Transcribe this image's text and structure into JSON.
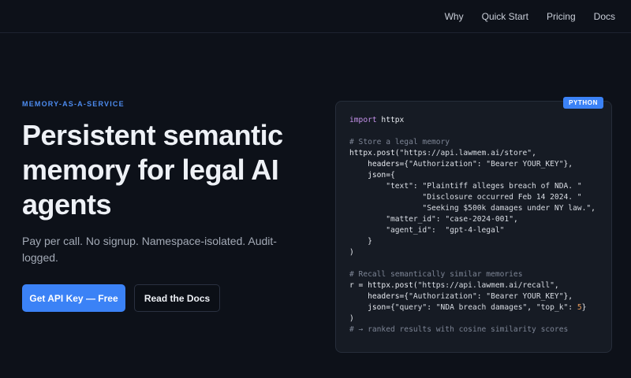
{
  "nav": {
    "links": [
      "Why",
      "Quick Start",
      "Pricing",
      "Docs"
    ]
  },
  "hero": {
    "eyebrow": "MEMORY-AS-A-SERVICE",
    "headline": "Persistent semantic memory for legal AI agents",
    "subtitle": "Pay per call. No signup. Namespace-isolated. Audit-logged.",
    "primary_cta": "Get API Key — Free",
    "secondary_cta": "Read the Docs"
  },
  "code_card": {
    "language_badge": "PYTHON",
    "lines": [
      [
        [
          "kw",
          "import"
        ],
        [
          "plain",
          " httpx"
        ]
      ],
      [],
      [
        [
          "com",
          "# Store a legal memory"
        ]
      ],
      [
        [
          "plain",
          "httpx.post("
        ],
        [
          "str",
          "\"https://api.lawmem.ai/store\""
        ],
        [
          "plain",
          ","
        ]
      ],
      [
        [
          "plain",
          "    headers={"
        ],
        [
          "str",
          "\"Authorization\""
        ],
        [
          "plain",
          ": "
        ],
        [
          "str",
          "\"Bearer YOUR_KEY\""
        ],
        [
          "plain",
          "},"
        ]
      ],
      [
        [
          "plain",
          "    json={"
        ]
      ],
      [
        [
          "plain",
          "        "
        ],
        [
          "str",
          "\"text\""
        ],
        [
          "plain",
          ": "
        ],
        [
          "str",
          "\"Plaintiff alleges breach of NDA. \""
        ]
      ],
      [
        [
          "plain",
          "                "
        ],
        [
          "str",
          "\"Disclosure occurred Feb 14 2024. \""
        ]
      ],
      [
        [
          "plain",
          "                "
        ],
        [
          "str",
          "\"Seeking $500k damages under NY law.\""
        ],
        [
          "plain",
          ","
        ]
      ],
      [
        [
          "plain",
          "        "
        ],
        [
          "str",
          "\"matter_id\""
        ],
        [
          "plain",
          ": "
        ],
        [
          "str",
          "\"case-2024-001\""
        ],
        [
          "plain",
          ","
        ]
      ],
      [
        [
          "plain",
          "        "
        ],
        [
          "str",
          "\"agent_id\""
        ],
        [
          "plain",
          ":  "
        ],
        [
          "str",
          "\"gpt-4-legal\""
        ]
      ],
      [
        [
          "plain",
          "    }"
        ]
      ],
      [
        [
          "plain",
          ")"
        ]
      ],
      [],
      [
        [
          "com",
          "# Recall semantically similar memories"
        ]
      ],
      [
        [
          "plain",
          "r = httpx.post("
        ],
        [
          "str",
          "\"https://api.lawmem.ai/recall\""
        ],
        [
          "plain",
          ","
        ]
      ],
      [
        [
          "plain",
          "    headers={"
        ],
        [
          "str",
          "\"Authorization\""
        ],
        [
          "plain",
          ": "
        ],
        [
          "str",
          "\"Bearer YOUR_KEY\""
        ],
        [
          "plain",
          "},"
        ]
      ],
      [
        [
          "plain",
          "    json={"
        ],
        [
          "str",
          "\"query\""
        ],
        [
          "plain",
          ": "
        ],
        [
          "str",
          "\"NDA breach damages\""
        ],
        [
          "plain",
          ", "
        ],
        [
          "str",
          "\"top_k\""
        ],
        [
          "plain",
          ": "
        ],
        [
          "num",
          "5"
        ],
        [
          "plain",
          "}"
        ]
      ],
      [
        [
          "plain",
          ")"
        ]
      ],
      [
        [
          "com",
          "# → ranked results with cosine similarity scores"
        ]
      ]
    ]
  }
}
